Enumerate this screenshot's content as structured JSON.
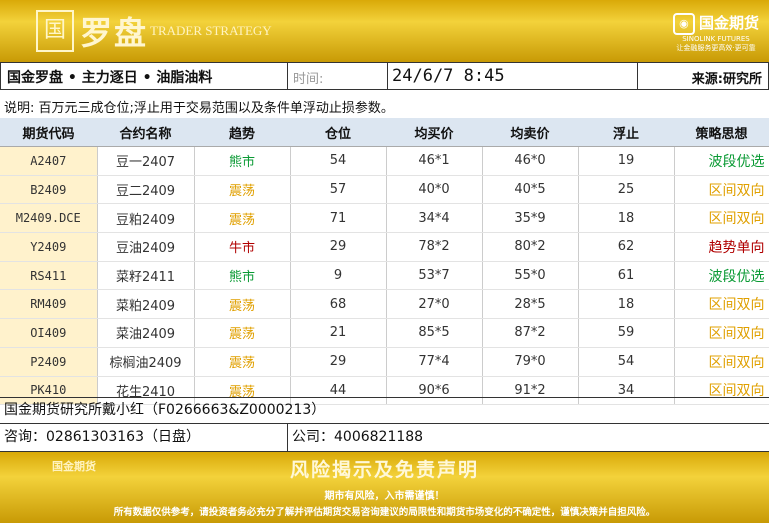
{
  "banner": {
    "logo_glyph": "国",
    "brand_cn": "罗盘",
    "brand_en": "TRADER STRATEGY",
    "company_name": "国金期货",
    "company_en": "SINOLINK FUTURES",
    "company_slogan": "让金融服务更高效·更可靠"
  },
  "info": {
    "title": "国金罗盘 • 主力逐日 • 油脂油料",
    "time_label": "时间:",
    "time_value": "24/6/7 8:45",
    "source": "来源:研究所"
  },
  "note": "说明: 百万元三成仓位;浮止用于交易范围以及条件单浮动止损参数。",
  "table": {
    "headers": [
      "期货代码",
      "合约名称",
      "趋势",
      "仓位",
      "均买价",
      "均卖价",
      "浮止",
      "策略思想"
    ],
    "rows": [
      {
        "code": "A2407",
        "name": "豆一2407",
        "trend": "熊市",
        "trend_color": "#0a9a34",
        "position": "54",
        "buy": "46*1",
        "sell": "46*0",
        "stop": "19",
        "strategy": "波段优选",
        "strategy_color": "#0a9a34"
      },
      {
        "code": "B2409",
        "name": "豆二2409",
        "trend": "震荡",
        "trend_color": "#e0a000",
        "position": "57",
        "buy": "40*0",
        "sell": "40*5",
        "stop": "25",
        "strategy": "区间双向",
        "strategy_color": "#e0a000"
      },
      {
        "code": "M2409.DCE",
        "name": "豆粕2409",
        "trend": "震荡",
        "trend_color": "#e0a000",
        "position": "71",
        "buy": "34*4",
        "sell": "35*9",
        "stop": "18",
        "strategy": "区间双向",
        "strategy_color": "#e0a000"
      },
      {
        "code": "Y2409",
        "name": "豆油2409",
        "trend": "牛市",
        "trend_color": "#b00000",
        "position": "29",
        "buy": "78*2",
        "sell": "80*2",
        "stop": "62",
        "strategy": "趋势单向",
        "strategy_color": "#b00000"
      },
      {
        "code": "RS411",
        "name": "菜籽2411",
        "trend": "熊市",
        "trend_color": "#0a9a34",
        "position": "9",
        "buy": "53*7",
        "sell": "55*0",
        "stop": "61",
        "strategy": "波段优选",
        "strategy_color": "#0a9a34"
      },
      {
        "code": "RM409",
        "name": "菜粕2409",
        "trend": "震荡",
        "trend_color": "#e0a000",
        "position": "68",
        "buy": "27*0",
        "sell": "28*5",
        "stop": "18",
        "strategy": "区间双向",
        "strategy_color": "#e0a000"
      },
      {
        "code": "OI409",
        "name": "菜油2409",
        "trend": "震荡",
        "trend_color": "#e0a000",
        "position": "21",
        "buy": "85*5",
        "sell": "87*2",
        "stop": "59",
        "strategy": "区间双向",
        "strategy_color": "#e0a000"
      },
      {
        "code": "P2409",
        "name": "棕榈油2409",
        "trend": "震荡",
        "trend_color": "#e0a000",
        "position": "29",
        "buy": "77*4",
        "sell": "79*0",
        "stop": "54",
        "strategy": "区间双向",
        "strategy_color": "#e0a000"
      },
      {
        "code": "PK410",
        "name": "花生2410",
        "trend": "震荡",
        "trend_color": "#e0a000",
        "position": "44",
        "buy": "90*6",
        "sell": "91*2",
        "stop": "34",
        "strategy": "区间双向",
        "strategy_color": "#e0a000"
      }
    ]
  },
  "footer": {
    "analyst": "国金期货研究所戴小红（F0266663&Z0000213）",
    "consult": "咨询：02861303163（日盘）",
    "company_phone": "公司：4006821188"
  },
  "disclaimer": {
    "logo": "国金期货",
    "title": "风险揭示及免责声明",
    "subtitle": "期市有风险，入市需谨慎！",
    "text": "所有数据仅供参考，请投资者务必充分了解并评估期货交易咨询建议的局限性和期货市场变化的不确定性，谨慎决策并自担风险。"
  }
}
